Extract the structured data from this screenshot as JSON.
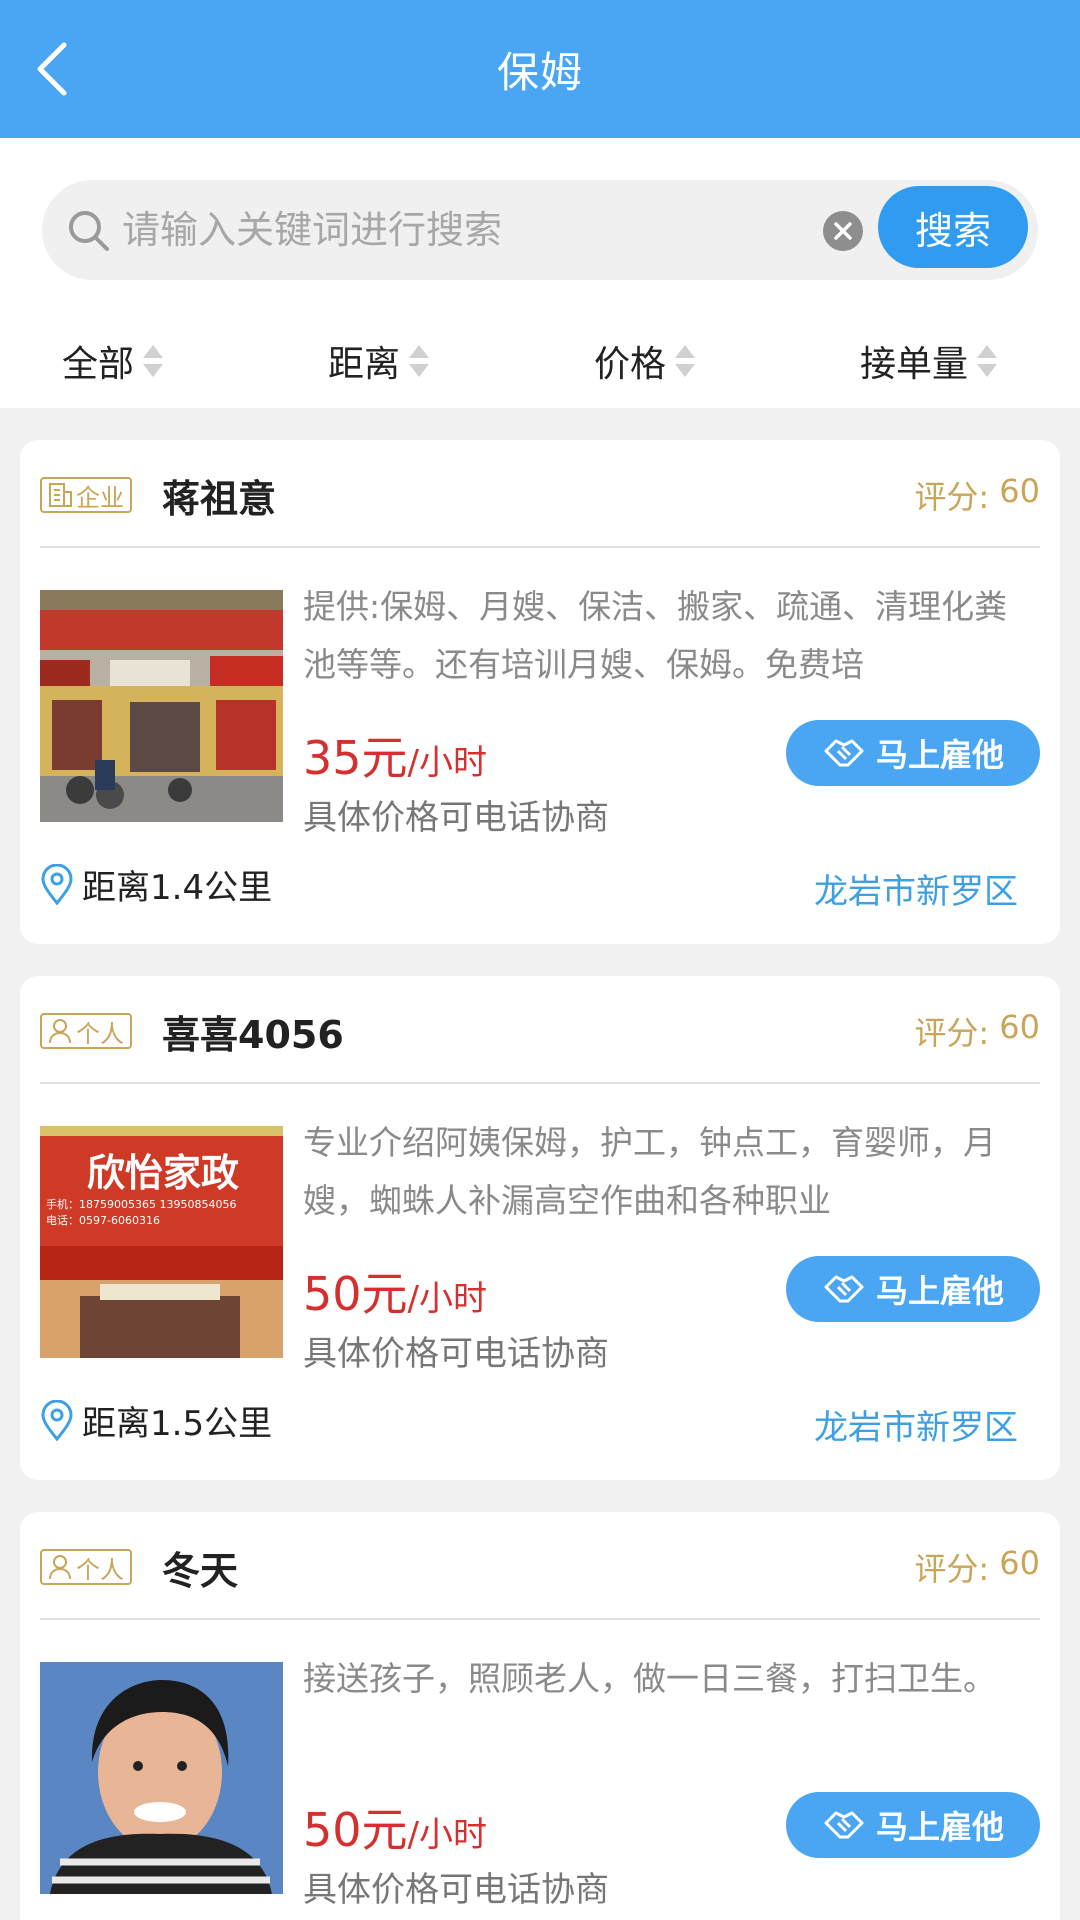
{
  "header": {
    "title": "保姆"
  },
  "search": {
    "placeholder": "请输入关键词进行搜索",
    "button_label": "搜索"
  },
  "filters": [
    {
      "label": "全部"
    },
    {
      "label": "距离"
    },
    {
      "label": "价格"
    },
    {
      "label": "接单量"
    }
  ],
  "rating_label": "评分:",
  "listings": [
    {
      "tag": "企业",
      "tag_icon": "building-icon",
      "name": "蒋祖意",
      "rating": "60",
      "description": "提供:保姆、月嫂、保洁、搬家、疏通、清理化粪池等等。还有培训月嫂、保姆。免费培",
      "price_value": "35元",
      "price_unit": "/小时",
      "price_note": "具体价格可电话协商",
      "hire_label": "马上雇他",
      "distance": "距离1.4公里",
      "region": "龙岩市新罗区"
    },
    {
      "tag": "个人",
      "tag_icon": "person-icon",
      "name": "喜喜4056",
      "rating": "60",
      "description": "专业介绍阿姨保姆，护工，钟点工，育婴师，月嫂，蜘蛛人补漏高空作曲和各种职业",
      "price_value": "50元",
      "price_unit": "/小时",
      "price_note": "具体价格可电话协商",
      "hire_label": "马上雇他",
      "distance": "距离1.5公里",
      "region": "龙岩市新罗区",
      "photo_sign": "欣怡家政",
      "photo_phone": "手机：18759005365 13950854056",
      "photo_tel": "电话：0597-6060316"
    },
    {
      "tag": "个人",
      "tag_icon": "person-icon",
      "name": "冬天",
      "rating": "60",
      "description": "接送孩子，照顾老人，做一日三餐，打扫卫生。",
      "price_value": "50元",
      "price_unit": "/小时",
      "price_note": "具体价格可电话协商",
      "hire_label": "马上雇他"
    }
  ],
  "colors": {
    "header": "#4aa6f3",
    "accent": "#2f9cf1",
    "price": "#d53030",
    "gold": "#c9a55a",
    "region": "#3ea0e4"
  }
}
